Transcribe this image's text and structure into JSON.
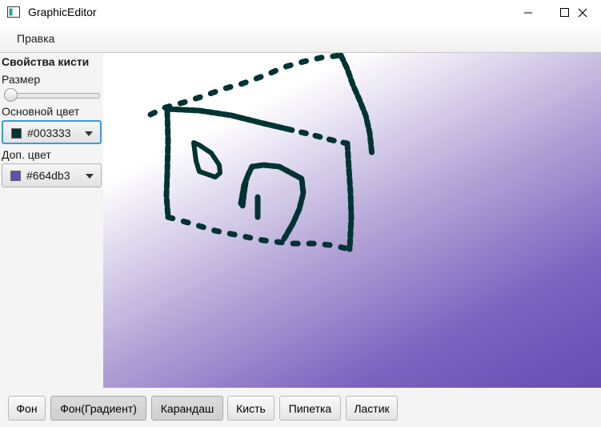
{
  "window": {
    "title": "GraphicEditor",
    "minimize_icon": "minimize-icon",
    "maximize_icon": "maximize-icon",
    "close_icon": "close-icon"
  },
  "menubar": {
    "items": [
      {
        "label": "Правка"
      }
    ]
  },
  "sidebar": {
    "title": "Свойства кисти",
    "size_label": "Размер",
    "size_value_fraction": 0.0,
    "primary_color_label": "Основной цвет",
    "primary_color": "#003333",
    "secondary_color_label": "Доп. цвет",
    "secondary_color": "#664db3"
  },
  "canvas": {
    "gradient_start": "#ffffff",
    "gradient_end": "#664db3",
    "stroke_color": "#003333"
  },
  "toolbar": {
    "buttons": [
      {
        "label": "Фон"
      },
      {
        "label": "Фон(Градиент)"
      },
      {
        "label": "Карандаш"
      },
      {
        "label": "Кисть"
      },
      {
        "label": "Пипетка"
      },
      {
        "label": "Ластик"
      }
    ]
  }
}
